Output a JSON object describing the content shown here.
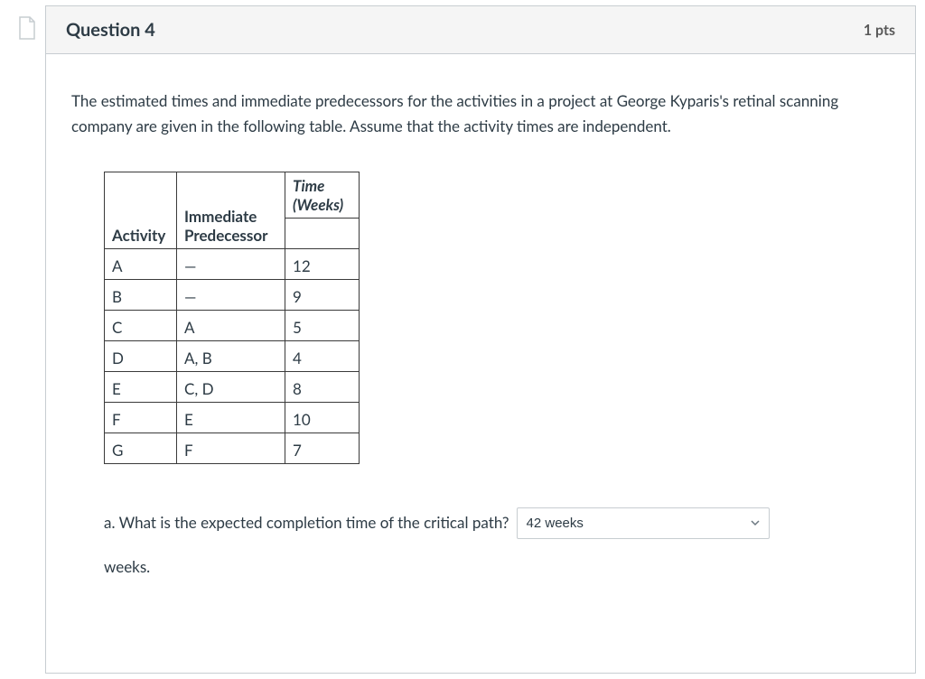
{
  "header": {
    "title": "Question 4",
    "points": "1 pts"
  },
  "prompt": "The estimated times and immediate predecessors for the activities in a project at George Kyparis's retinal scanning company are given in the following table. Assume that the activity times are independent.",
  "table": {
    "headers": {
      "activity": "Activity",
      "predecessor": "Immediate Predecessor",
      "time": "Time (Weeks)"
    },
    "rows": [
      {
        "activity": "A",
        "pred": "—",
        "time": "12"
      },
      {
        "activity": "B",
        "pred": "—",
        "time": "9"
      },
      {
        "activity": "C",
        "pred": "A",
        "time": "5"
      },
      {
        "activity": "D",
        "pred": "A, B",
        "time": "4"
      },
      {
        "activity": "E",
        "pred": "C, D",
        "time": "8"
      },
      {
        "activity": "F",
        "pred": "E",
        "time": "10"
      },
      {
        "activity": "G",
        "pred": "F",
        "time": "7"
      }
    ]
  },
  "answer": {
    "prompt_a": "a. What is the expected completion time of the critical path?",
    "selected": "42 weeks",
    "unit_suffix": "weeks."
  }
}
